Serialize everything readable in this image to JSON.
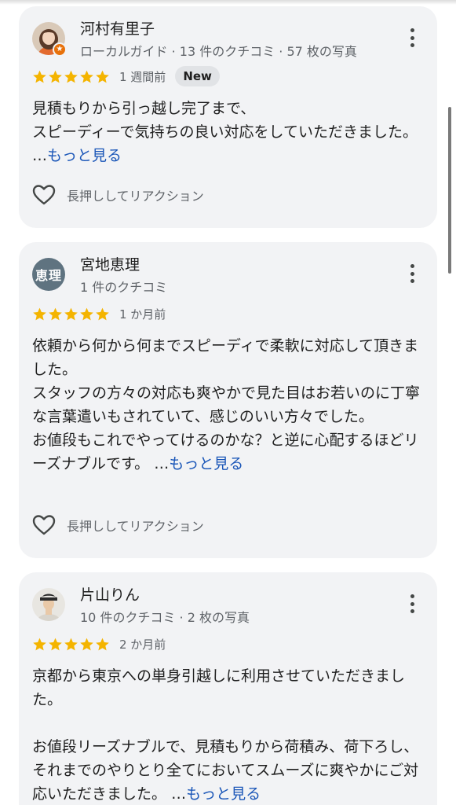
{
  "reviews": [
    {
      "name": "河村有里子",
      "meta": "ローカルガイド · 13 件のクチコミ · 57 枚の写真",
      "avatar": {
        "type": "photo",
        "badge": "star-badge-icon"
      },
      "rating": 5,
      "time": "1 週間前",
      "badge": "New",
      "text": "見積もりから引っ越し完了まで、\nスピーディーで気持ちの良い対応をしていただきました。",
      "ellipsis": "…",
      "more": "もっと見る",
      "reaction": "長押ししてリアクション"
    },
    {
      "name": "宮地恵理",
      "meta": "1 件のクチコミ",
      "avatar": {
        "type": "initials",
        "initials": "恵理",
        "color": "#5f7380"
      },
      "rating": 5,
      "time": "1 か月前",
      "text": "依頼から何から何までスピーディで柔軟に対応して頂きました。\nスタッフの方々の対応も爽やかで見た目はお若いのに丁寧な言葉遣いもされていて、感じのいい方々でした。\nお値段もこれでやってけるのかな？と逆に心配するほどリーズナブルです。",
      "ellipsis": "…",
      "more": "もっと見る",
      "reaction": "長押ししてリアクション"
    },
    {
      "name": "片山りん",
      "meta": "10 件のクチコミ · 2 枚の写真",
      "avatar": {
        "type": "photo"
      },
      "rating": 5,
      "time": "2 か月前",
      "text": "京都から東京への単身引越しに利用させていただきました。\n\nお値段リーズナブルで、見積もりから荷積み、荷下ろし、それまでのやりとり全てにおいてスムーズに爽やかにご対応いただきました。",
      "ellipsis": "…",
      "more": "もっと見る"
    }
  ],
  "colors": {
    "card_bg": "#f2f3f5",
    "star": "#f4b400",
    "link": "#1a56b8",
    "meta_text": "#5f6368"
  },
  "icons": {
    "more": "more-vert-icon",
    "star": "star-icon",
    "reaction": "heart-outline-icon"
  }
}
